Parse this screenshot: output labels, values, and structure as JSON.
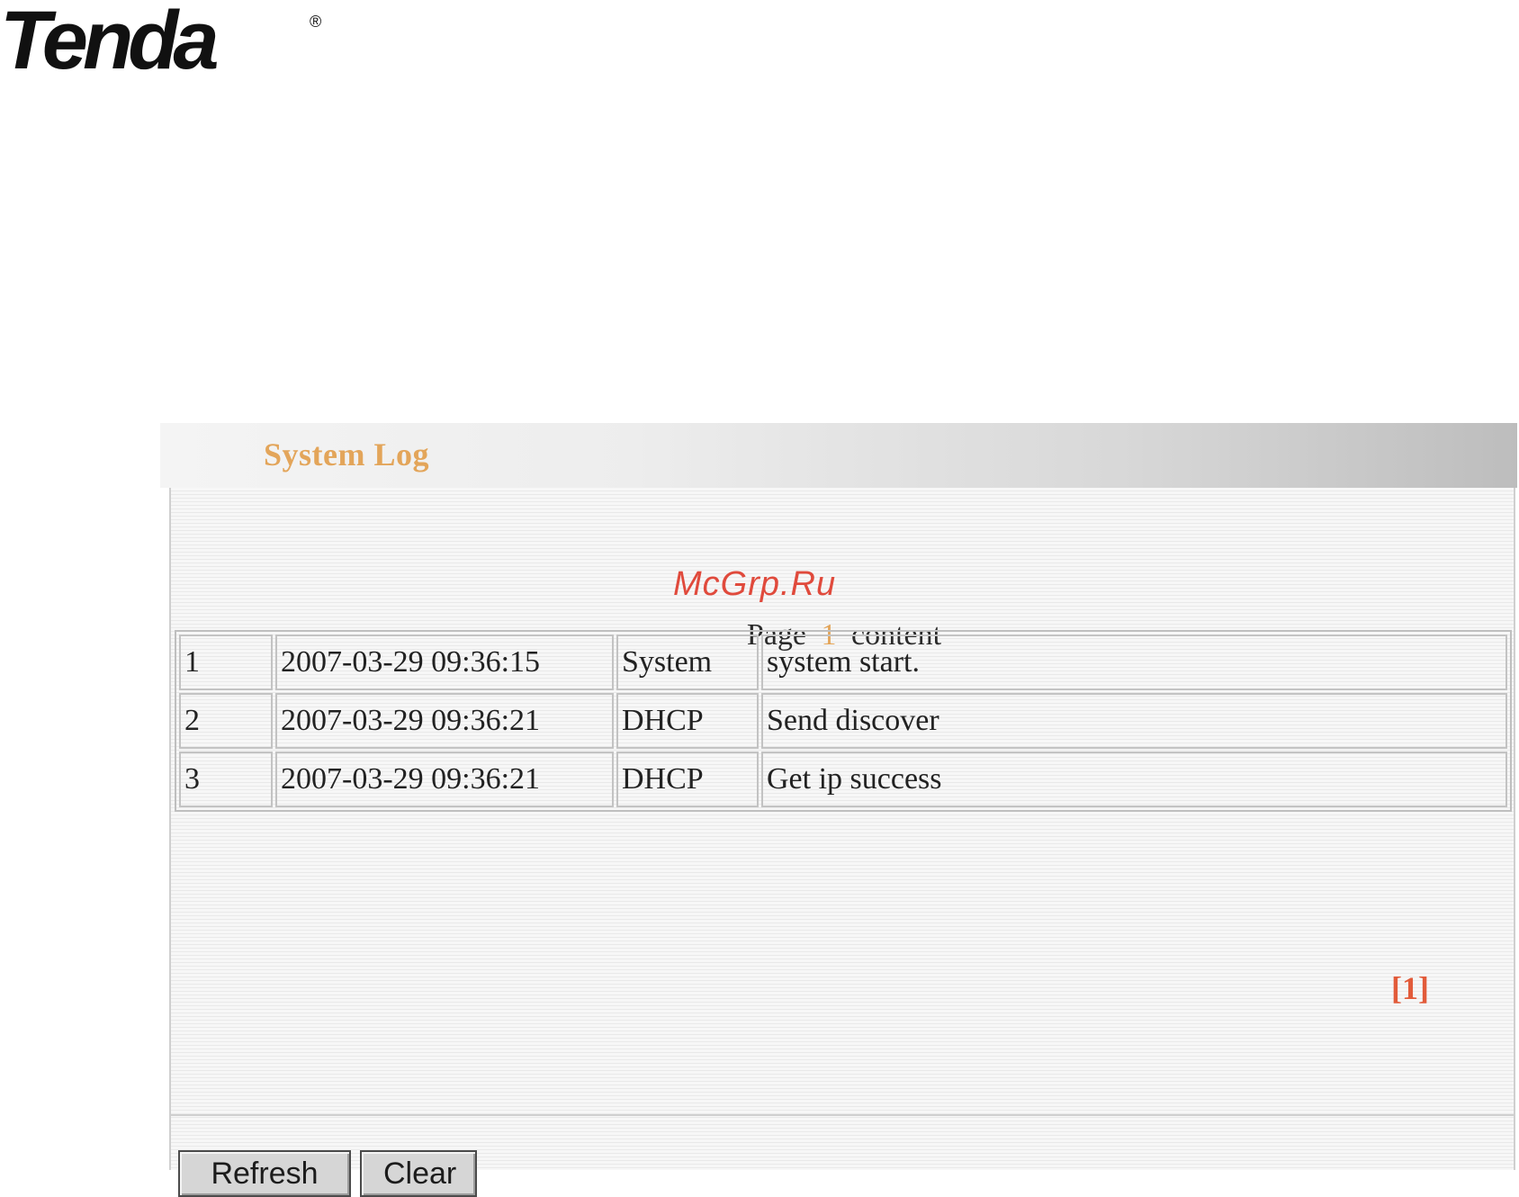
{
  "brand": {
    "logo_text": "Tenda",
    "logo_mark": "®"
  },
  "panel": {
    "title": "System Log",
    "page_word": "Page",
    "page_number": "1",
    "content_word": "content",
    "pager_link": "[1]"
  },
  "log": {
    "rows": [
      {
        "num": "1",
        "time": "2007-03-29 09:36:15",
        "type": "System",
        "message": "system start."
      },
      {
        "num": "2",
        "time": "2007-03-29 09:36:21",
        "type": "DHCP",
        "message": "Send discover"
      },
      {
        "num": "3",
        "time": "2007-03-29 09:36:21",
        "type": "DHCP",
        "message": "Get ip success"
      }
    ]
  },
  "buttons": {
    "refresh_label": "Refresh",
    "clear_label": "Clear"
  },
  "watermark": {
    "text": "McGrp.Ru"
  },
  "colors": {
    "title_accent": "#e3a55a",
    "pager_accent": "#e25b3a",
    "watermark": "#e04a3c"
  }
}
